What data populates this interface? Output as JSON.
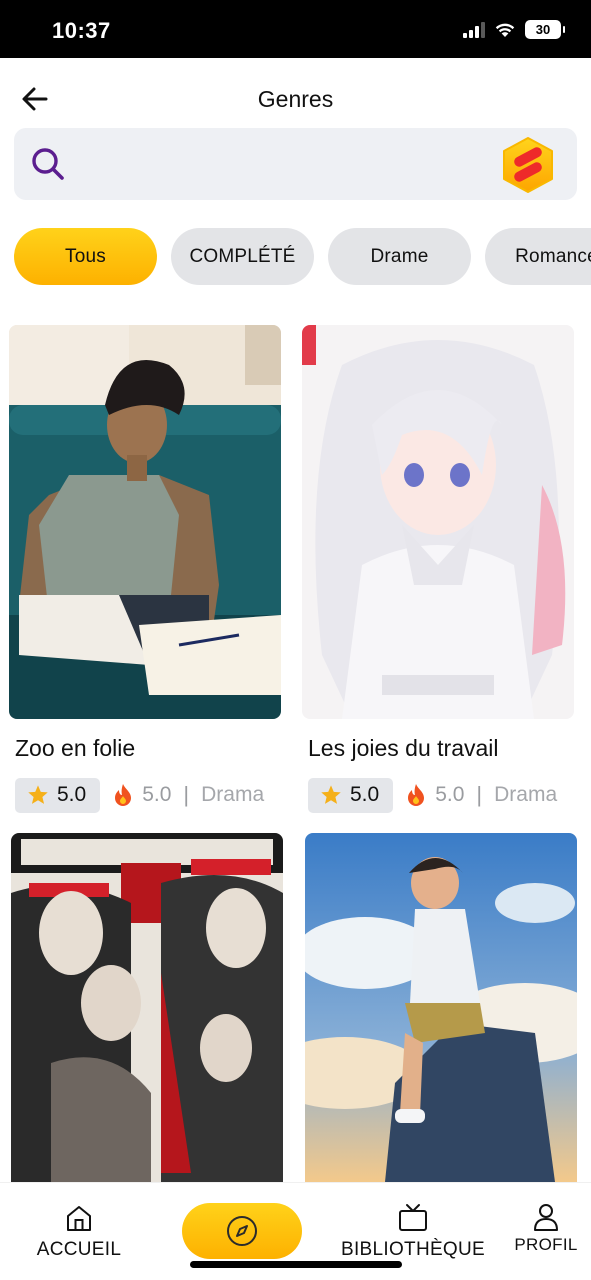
{
  "status_bar": {
    "time": "10:37",
    "battery": "30"
  },
  "header": {
    "title": "Genres",
    "back_icon": "arrow-left-icon"
  },
  "search": {
    "placeholder": "",
    "icon": "search-icon",
    "logo_icon": "app-logo-icon"
  },
  "chips": [
    {
      "label": "Tous",
      "active": true
    },
    {
      "label": "COMPLÉTÉ",
      "active": false
    },
    {
      "label": "Drame",
      "active": false
    },
    {
      "label": "Romance",
      "active": false
    }
  ],
  "cards": [
    {
      "title": "Zoo en folie",
      "rating": "5.0",
      "hot": "5.0",
      "separator": "|",
      "genre": "Drama",
      "cover": "man-on-sofa-reading"
    },
    {
      "title": "Les joies du travail",
      "rating": "5.0",
      "hot": "5.0",
      "separator": "|",
      "genre": "Drama",
      "cover": "white-haired-girl"
    },
    {
      "title": "",
      "rating": "",
      "hot": "",
      "separator": "",
      "genre": "",
      "cover": "red-headband-warriors"
    },
    {
      "title": "",
      "rating": "",
      "hot": "",
      "separator": "",
      "genre": "",
      "cover": "boy-on-rock-sky"
    }
  ],
  "bottom_nav": {
    "home": {
      "label": "ACCUEIL",
      "icon": "home-icon"
    },
    "discover": {
      "label": "",
      "icon": "compass-icon"
    },
    "library": {
      "label": "BIBLIOTHÈQUE",
      "icon": "tv-icon"
    },
    "profile": {
      "label": "PROFIL",
      "icon": "user-icon"
    }
  },
  "colors": {
    "accent_yellow": "#fdc100",
    "chip_gray": "#e3e4e7",
    "search_bg": "#eef0f4",
    "search_icon": "#5b1e8f",
    "logo_red": "#ee2a2a"
  }
}
